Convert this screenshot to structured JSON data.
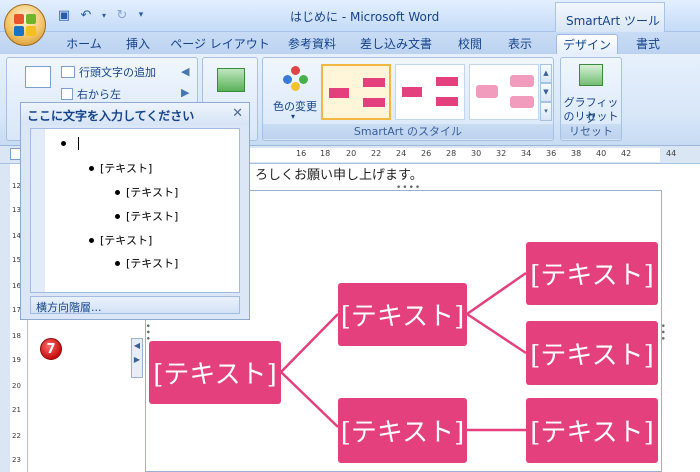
{
  "window": {
    "title": "はじめに - Microsoft Word",
    "context_tab_title": "SmartArt ツール"
  },
  "quick_access": {
    "save_icon": "save-icon",
    "undo_icon": "undo-icon",
    "redo_icon": "redo-icon",
    "customize_icon": "dropdown-icon"
  },
  "tabs": [
    {
      "label": "ホーム"
    },
    {
      "label": "挿入"
    },
    {
      "label": "ページ レイアウト"
    },
    {
      "label": "参考資料"
    },
    {
      "label": "差し込み文書"
    },
    {
      "label": "校閲"
    },
    {
      "label": "表示"
    },
    {
      "label": "デザイン",
      "active": true
    },
    {
      "label": "書式"
    }
  ],
  "ribbon": {
    "create_graphic": {
      "add_bullet": "行頭文字の追加",
      "right_to_left": "右から左"
    },
    "styles": {
      "color_change": "色の変更",
      "group_label": "SmartArt のスタイル"
    },
    "reset": {
      "reset_graphic_line1": "グラフィック",
      "reset_graphic_line2": "のリセット",
      "group_label": "リセット"
    }
  },
  "ruler": {
    "ticks": [
      "16",
      "18",
      "20",
      "22",
      "24",
      "26",
      "28",
      "30",
      "32",
      "34",
      "36",
      "38",
      "40",
      "42",
      "44"
    ],
    "vticks": [
      "12",
      "13",
      "14",
      "15",
      "16",
      "17",
      "18",
      "19",
      "20",
      "21",
      "22",
      "23"
    ]
  },
  "document": {
    "text": "ろしくお願い申し上げます。"
  },
  "text_pane": {
    "title": "ここに文字を入力してください",
    "close_icon": "close-icon",
    "items": [
      {
        "level": 1,
        "text": ""
      },
      {
        "level": 2,
        "text": "[テキスト]"
      },
      {
        "level": 3,
        "text": "[テキスト]"
      },
      {
        "level": 3,
        "text": "[テキスト]"
      },
      {
        "level": 2,
        "text": "[テキスト]"
      },
      {
        "level": 3,
        "text": "[テキスト]"
      }
    ],
    "footer": "横方向階層..."
  },
  "badge": {
    "label": "7"
  },
  "smartart": {
    "accent_color": "#e5407e",
    "root": "[テキスト]",
    "level2": [
      "[テキスト]",
      "[テキスト]"
    ],
    "level3": [
      "[テキスト]",
      "[テキスト]",
      "[テキスト]"
    ]
  }
}
